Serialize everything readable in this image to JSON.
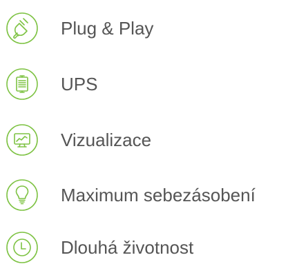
{
  "theme": {
    "accent_color": "#7dc242",
    "text_color": "#555555"
  },
  "features": [
    {
      "icon": "plug-icon",
      "label": "Plug & Play"
    },
    {
      "icon": "ups-icon",
      "label": "UPS"
    },
    {
      "icon": "monitor-chart-icon",
      "label": "Vizualizace"
    },
    {
      "icon": "lightbulb-icon",
      "label": "Maximum sebezásobení"
    },
    {
      "icon": "clock-icon",
      "label": "Dlouhá životnost"
    }
  ]
}
